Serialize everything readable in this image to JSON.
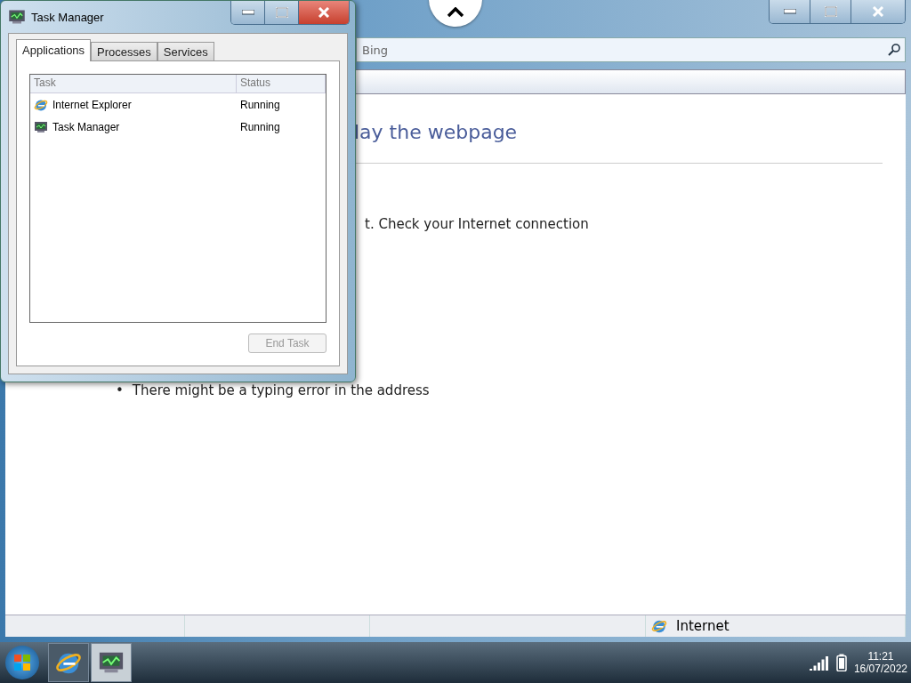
{
  "browser": {
    "search": {
      "placeholder": "Bing"
    },
    "heading": "lay the webpage",
    "message": "t. Check your Internet connection",
    "bullets": [
      {
        "marker": "•",
        "text": "There might be a typing error in the address"
      }
    ],
    "status_bar": {
      "zone": "Internet"
    }
  },
  "task_manager": {
    "title": "Task Manager",
    "tabs": [
      {
        "label": "Applications",
        "selected": true
      },
      {
        "label": "Processes",
        "selected": false
      },
      {
        "label": "Services",
        "selected": false
      }
    ],
    "columns": [
      "Task",
      "Status"
    ],
    "rows": [
      {
        "kind": "browser",
        "task": "Internet Explorer",
        "status": "Running"
      },
      {
        "kind": "monitor",
        "task": "Task Manager",
        "status": "Running"
      }
    ],
    "end_task": {
      "label": "End Task",
      "disabled": true
    }
  },
  "taskbar": {
    "apps": [
      {
        "kind": "browser",
        "selected": false
      },
      {
        "kind": "monitor",
        "selected": true
      }
    ],
    "time": "11:21",
    "date": "16/07/2022"
  }
}
